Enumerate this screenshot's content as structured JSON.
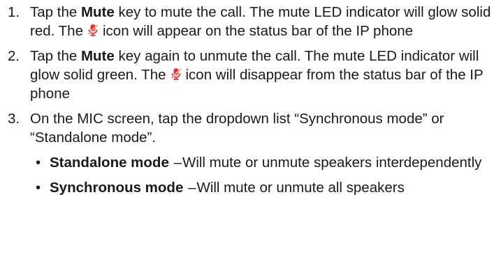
{
  "steps": [
    {
      "number": "1.",
      "lead": "Tap the",
      "key": "Mute",
      "after_key": "key to mute the call. The mute LED indicator will glow solid red. The",
      "icon": "muted-microphone-icon",
      "after_icon": "icon will appear on the status bar of the IP phone"
    },
    {
      "number": "2.",
      "lead": "Tap the",
      "key": "Mute",
      "after_key": "key again to unmute the call. The mute LED indicator will glow solid green. The",
      "icon": "muted-microphone-icon",
      "after_icon": "icon will disappear from the status bar of the IP phone"
    },
    {
      "number": "3.",
      "text": "On the MIC screen, tap the dropdown list “Synchronous mode” or “Standalone mode”.",
      "subitems": [
        {
          "bullet": "•",
          "term": "Standalone mode",
          "separator": "–",
          "desc": "Will mute or unmute speakers interdependently"
        },
        {
          "bullet": "•",
          "term": "Synchronous mode",
          "separator": "–",
          "desc": "Will mute or unmute all speakers"
        }
      ]
    }
  ],
  "colors": {
    "text": "#1a1a1a",
    "icon_red": "#e5322d",
    "icon_highlight": "#f6a6a0"
  }
}
